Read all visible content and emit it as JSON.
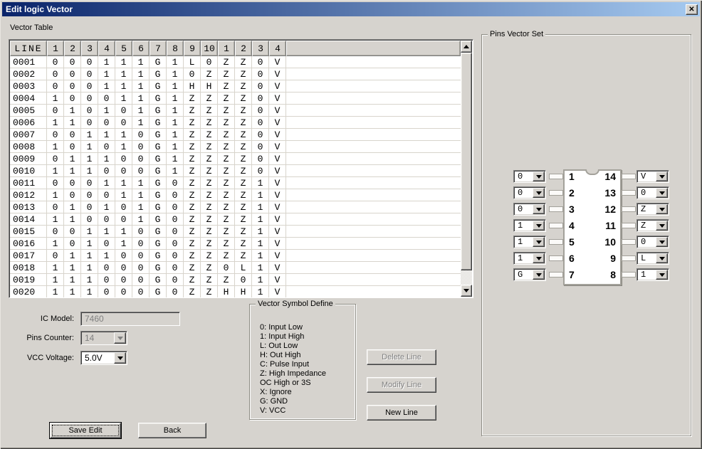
{
  "window": {
    "title": "Edit logic Vector"
  },
  "icons": {
    "close": "✕",
    "dropdown_arrow": "triangle-down",
    "scroll_up": "triangle-up",
    "scroll_down": "triangle-down"
  },
  "vector_table": {
    "label": "Vector Table",
    "headers": [
      "LINE",
      "1",
      "2",
      "3",
      "4",
      "5",
      "6",
      "7",
      "8",
      "9",
      "10",
      "1",
      "2",
      "3",
      "4"
    ],
    "rows": [
      {
        "line": "0001",
        "values": [
          "0",
          "0",
          "0",
          "1",
          "1",
          "1",
          "G",
          "1",
          "L",
          "0",
          "Z",
          "Z",
          "0",
          "V"
        ]
      },
      {
        "line": "0002",
        "values": [
          "0",
          "0",
          "0",
          "1",
          "1",
          "1",
          "G",
          "1",
          "0",
          "Z",
          "Z",
          "Z",
          "0",
          "V"
        ]
      },
      {
        "line": "0003",
        "values": [
          "0",
          "0",
          "0",
          "1",
          "1",
          "1",
          "G",
          "1",
          "H",
          "H",
          "Z",
          "Z",
          "0",
          "V"
        ]
      },
      {
        "line": "0004",
        "values": [
          "1",
          "0",
          "0",
          "0",
          "1",
          "1",
          "G",
          "1",
          "Z",
          "Z",
          "Z",
          "Z",
          "0",
          "V"
        ]
      },
      {
        "line": "0005",
        "values": [
          "0",
          "1",
          "0",
          "1",
          "0",
          "1",
          "G",
          "1",
          "Z",
          "Z",
          "Z",
          "Z",
          "0",
          "V"
        ]
      },
      {
        "line": "0006",
        "values": [
          "1",
          "1",
          "0",
          "0",
          "0",
          "1",
          "G",
          "1",
          "Z",
          "Z",
          "Z",
          "Z",
          "0",
          "V"
        ]
      },
      {
        "line": "0007",
        "values": [
          "0",
          "0",
          "1",
          "1",
          "1",
          "0",
          "G",
          "1",
          "Z",
          "Z",
          "Z",
          "Z",
          "0",
          "V"
        ]
      },
      {
        "line": "0008",
        "values": [
          "1",
          "0",
          "1",
          "0",
          "1",
          "0",
          "G",
          "1",
          "Z",
          "Z",
          "Z",
          "Z",
          "0",
          "V"
        ]
      },
      {
        "line": "0009",
        "values": [
          "0",
          "1",
          "1",
          "1",
          "0",
          "0",
          "G",
          "1",
          "Z",
          "Z",
          "Z",
          "Z",
          "0",
          "V"
        ]
      },
      {
        "line": "0010",
        "values": [
          "1",
          "1",
          "1",
          "0",
          "0",
          "0",
          "G",
          "1",
          "Z",
          "Z",
          "Z",
          "Z",
          "0",
          "V"
        ]
      },
      {
        "line": "0011",
        "values": [
          "0",
          "0",
          "0",
          "1",
          "1",
          "1",
          "G",
          "0",
          "Z",
          "Z",
          "Z",
          "Z",
          "1",
          "V"
        ]
      },
      {
        "line": "0012",
        "values": [
          "1",
          "0",
          "0",
          "0",
          "1",
          "1",
          "G",
          "0",
          "Z",
          "Z",
          "Z",
          "Z",
          "1",
          "V"
        ]
      },
      {
        "line": "0013",
        "values": [
          "0",
          "1",
          "0",
          "1",
          "0",
          "1",
          "G",
          "0",
          "Z",
          "Z",
          "Z",
          "Z",
          "1",
          "V"
        ]
      },
      {
        "line": "0014",
        "values": [
          "1",
          "1",
          "0",
          "0",
          "0",
          "1",
          "G",
          "0",
          "Z",
          "Z",
          "Z",
          "Z",
          "1",
          "V"
        ]
      },
      {
        "line": "0015",
        "values": [
          "0",
          "0",
          "1",
          "1",
          "1",
          "0",
          "G",
          "0",
          "Z",
          "Z",
          "Z",
          "Z",
          "1",
          "V"
        ]
      },
      {
        "line": "0016",
        "values": [
          "1",
          "0",
          "1",
          "0",
          "1",
          "0",
          "G",
          "0",
          "Z",
          "Z",
          "Z",
          "Z",
          "1",
          "V"
        ]
      },
      {
        "line": "0017",
        "values": [
          "0",
          "1",
          "1",
          "1",
          "0",
          "0",
          "G",
          "0",
          "Z",
          "Z",
          "Z",
          "Z",
          "1",
          "V"
        ]
      },
      {
        "line": "0018",
        "values": [
          "1",
          "1",
          "1",
          "0",
          "0",
          "0",
          "G",
          "0",
          "Z",
          "Z",
          "0",
          "L",
          "1",
          "V"
        ]
      },
      {
        "line": "0019",
        "values": [
          "1",
          "1",
          "1",
          "0",
          "0",
          "0",
          "G",
          "0",
          "Z",
          "Z",
          "Z",
          "0",
          "1",
          "V"
        ]
      },
      {
        "line": "0020",
        "values": [
          "1",
          "1",
          "1",
          "0",
          "0",
          "0",
          "G",
          "0",
          "Z",
          "Z",
          "H",
          "H",
          "1",
          "V"
        ]
      }
    ]
  },
  "controls": {
    "ic_model_label": "IC Model:",
    "ic_model_value": "7460",
    "pins_counter_label": "Pins Counter:",
    "pins_counter_value": "14",
    "vcc_voltage_label": "VCC Voltage:",
    "vcc_voltage_value": "5.0V"
  },
  "symbol_define": {
    "label": "Vector Symbol Define",
    "lines": [
      "0: Input Low",
      "1: Input High",
      "L: Out Low",
      "H: Out High",
      "C: Pulse Input",
      "Z: High Impedance",
      " OC High or 3S",
      "X: Ignore",
      "G: GND",
      "V: VCC"
    ]
  },
  "buttons": {
    "delete_line": "Delete Line",
    "modify_line": "Modify Line",
    "new_line": "New Line",
    "save_edit": "Save Edit",
    "back": "Back"
  },
  "pins_vector_set": {
    "label": "Pins Vector Set",
    "left_pins": [
      {
        "pin": "1",
        "value": "0"
      },
      {
        "pin": "2",
        "value": "0"
      },
      {
        "pin": "3",
        "value": "0"
      },
      {
        "pin": "4",
        "value": "1"
      },
      {
        "pin": "5",
        "value": "1"
      },
      {
        "pin": "6",
        "value": "1"
      },
      {
        "pin": "7",
        "value": "G"
      }
    ],
    "right_pins": [
      {
        "pin": "14",
        "value": "V"
      },
      {
        "pin": "13",
        "value": "0"
      },
      {
        "pin": "12",
        "value": "Z"
      },
      {
        "pin": "11",
        "value": "Z"
      },
      {
        "pin": "10",
        "value": "0"
      },
      {
        "pin": "9",
        "value": "L"
      },
      {
        "pin": "8",
        "value": "1"
      }
    ]
  }
}
